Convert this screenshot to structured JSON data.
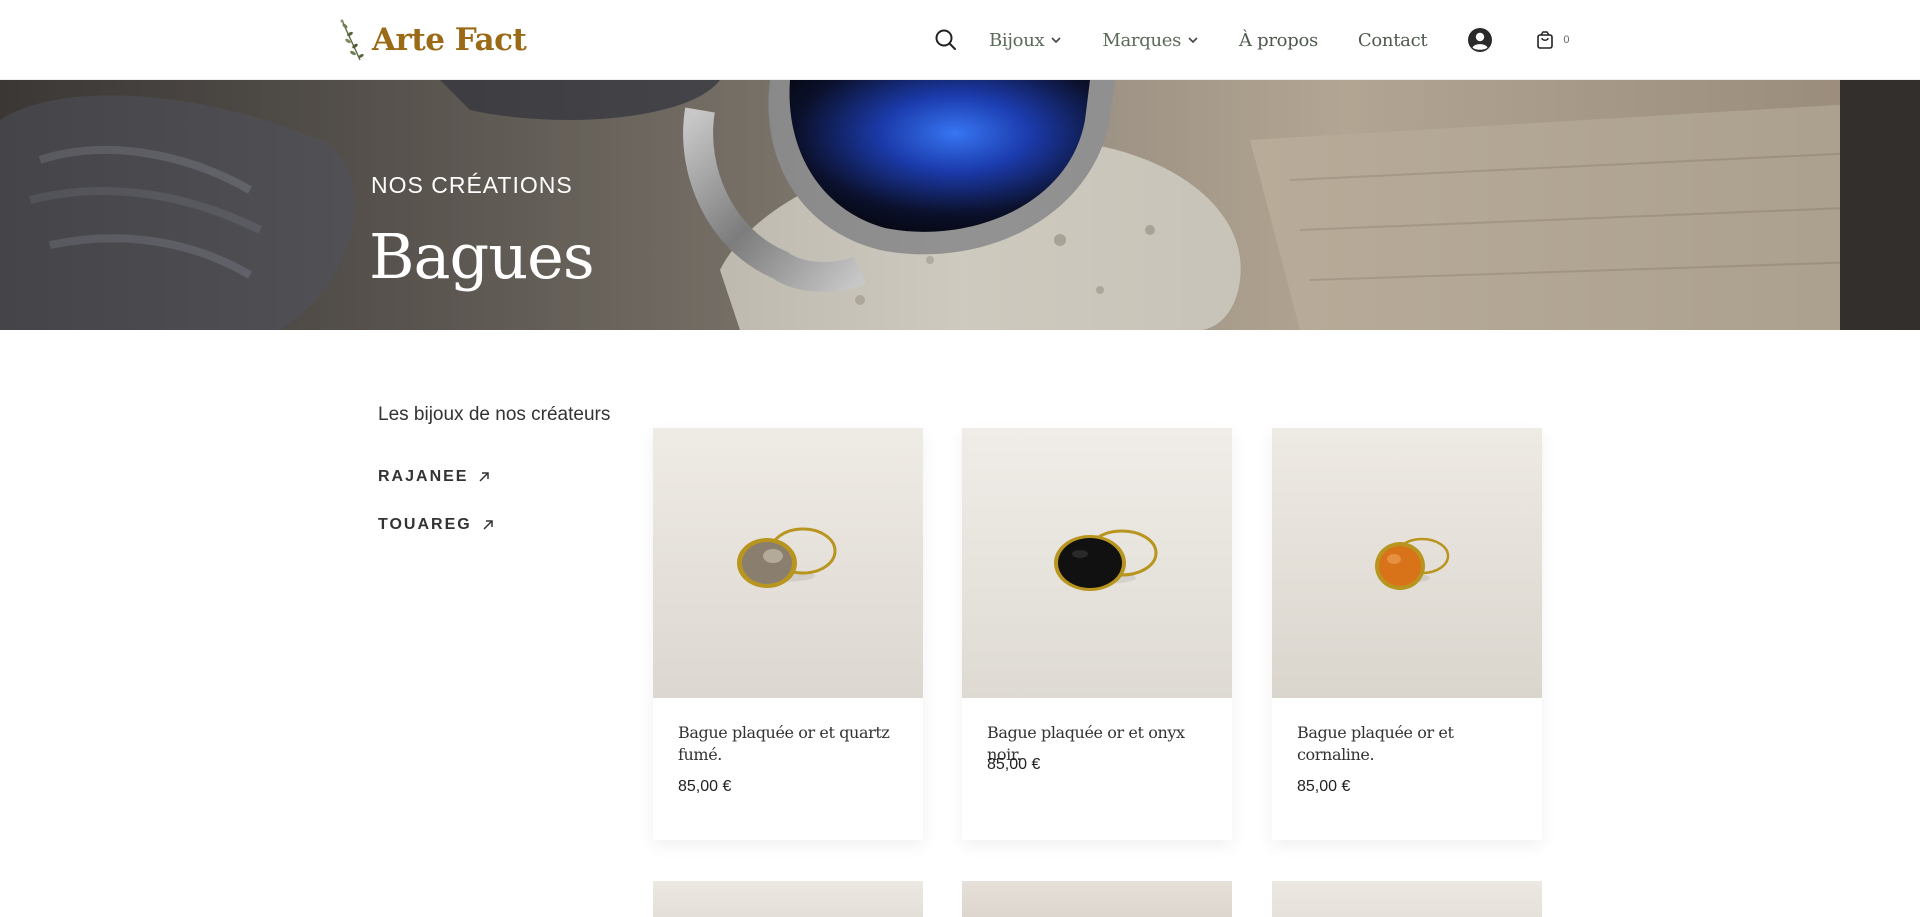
{
  "header": {
    "logo_text": "Arte Fact",
    "nav": {
      "bijoux": "Bijoux",
      "marques": "Marques",
      "apropos": "À propos",
      "contact": "Contact"
    },
    "cart_count": "0"
  },
  "hero": {
    "overline": "NOS CRÉATIONS",
    "title": "Bagues"
  },
  "sidebar": {
    "title": "Les bijoux de nos créateurs",
    "links": [
      "RAJANEE",
      "TOUAREG"
    ]
  },
  "products": [
    {
      "name": "Bague plaquée or et quartz fumé.",
      "price": "85,00 €",
      "stone_color": "#8a7f6e"
    },
    {
      "name": "Bague plaquée or et onyx noir.",
      "price": "85,00 €",
      "stone_color": "#111111"
    },
    {
      "name": "Bague plaquée or et cornaline.",
      "price": "85,00 €",
      "stone_color": "#d9731a"
    }
  ],
  "colors": {
    "brand_gold": "#9a6a16",
    "nav_green": "#5a6a58",
    "ring_gold": "#c9a227"
  }
}
